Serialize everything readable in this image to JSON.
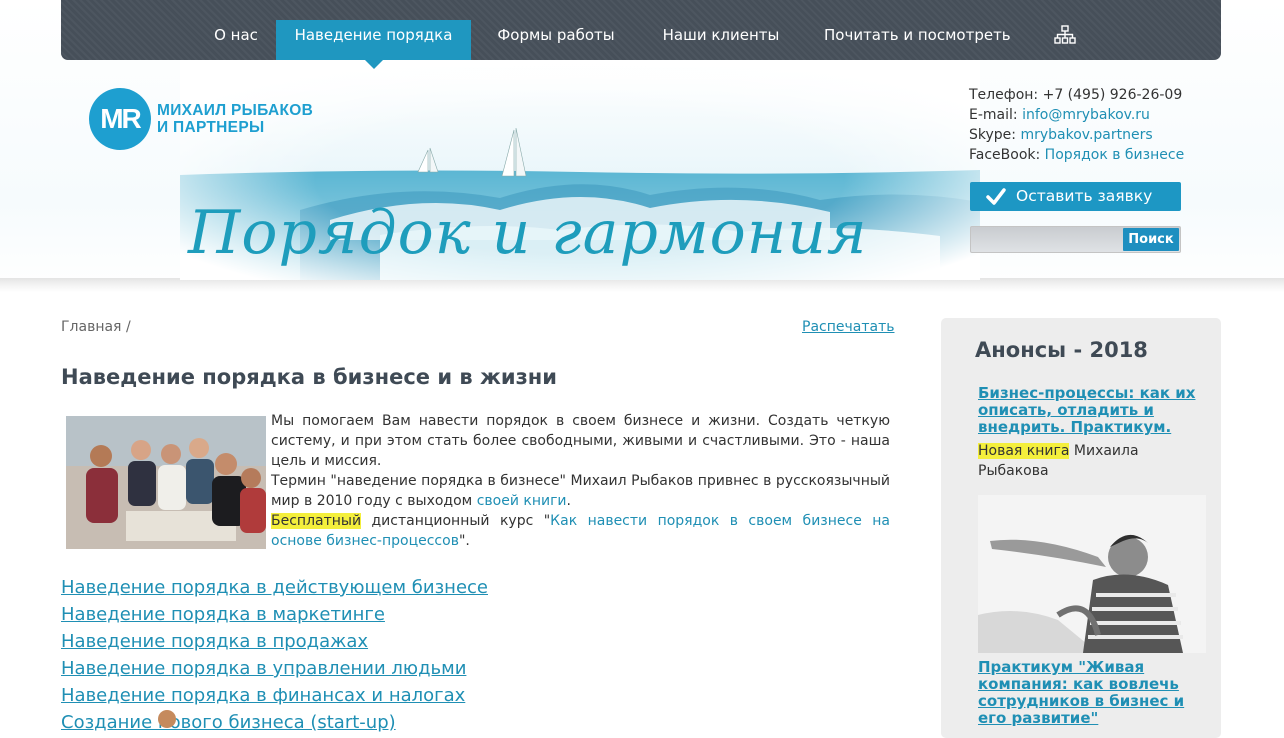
{
  "nav": {
    "items": [
      {
        "label": "О нас"
      },
      {
        "label": "Наведение порядка"
      },
      {
        "label": "Формы работы"
      },
      {
        "label": "Наши клиенты"
      },
      {
        "label": "Почитать и посмотреть"
      }
    ],
    "active_index": 1
  },
  "logo": {
    "mark": "MR",
    "line1": "МИХАИЛ РЫБАКОВ",
    "line2": "И ПАРТНЕРЫ"
  },
  "hero": {
    "slogan": "Порядок и гармония"
  },
  "contacts": {
    "phone_label": "Телефон:",
    "phone": "+7 (495) 926-26-09",
    "email_label": "E-mail:",
    "email": "info@mrybakov.ru",
    "skype_label": "Skype:",
    "skype": "mrybakov.partners",
    "facebook_label": "FaceBook:",
    "facebook": "Порядок в бизнесе"
  },
  "request_button": {
    "label": "Оставить заявку"
  },
  "search": {
    "value": "",
    "button": "Поиск"
  },
  "breadcrumb": {
    "home": "Главная",
    "separator": "/"
  },
  "print_link": "Распечатать",
  "page_title": "Наведение порядка в бизнесе и в жизни",
  "intro": {
    "p1": "Мы помогаем Вам навести порядок в своем бизнесе и жизни. Создать четкую систему, и при этом стать более свободными, живыми и счастливыми. Это - наша цель и миссия.",
    "p2_before": "Термин \"наведение порядка в бизнесе\" Михаил Рыбаков привнес в русскоязычный мир в 2010 году с выходом ",
    "p2_link": "своей книги",
    "p2_after": ".",
    "p3_highlight": "Бесплатный",
    "p3_before": " дистанционный курс \"",
    "p3_link": "Как навести порядок в своем бизнесе на основе бизнес-процессов",
    "p3_after": "\"."
  },
  "topics": [
    "Наведение порядка в действующем бизнесе",
    "Наведение порядка в маркетинге",
    "Наведение порядка в продажах",
    "Наведение порядка в управлении людьми",
    "Наведение порядка в финансах и налогах",
    "Создание нового бизнеса (start-up)"
  ],
  "sidebar": {
    "title": "Анонсы - 2018",
    "item1_link": "Бизнес-процессы: как их описать, отладить и внедрить. Практикум.",
    "item1_highlight": "Новая книга",
    "item1_text": " Михаила Рыбакова",
    "item2_link": "Практикум \"Живая компания: как вовлечь сотрудников в бизнес и его развитие\""
  },
  "colors": {
    "accent": "#1f97c0",
    "nav_bg": "#464f59",
    "link": "#1f8fb4",
    "highlight": "#f4ef3c",
    "sidebar_bg": "#ededed"
  }
}
